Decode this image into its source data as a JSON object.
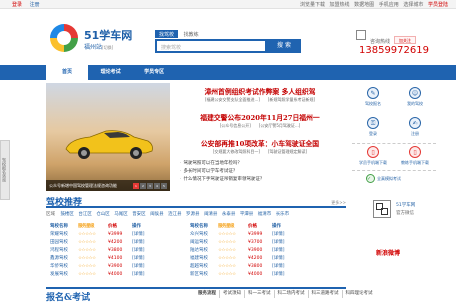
{
  "topbar": {
    "login": "登录",
    "register": "注册",
    "links": [
      "浏览量下载",
      "加盟热线",
      "数据地图",
      "手机应用",
      "选择城市",
      "学员登陆"
    ]
  },
  "brand": {
    "name": "51学车网",
    "city": "福州站",
    "city_tag": "[切换]"
  },
  "search": {
    "tabs": [
      "找驾校",
      "找教练"
    ],
    "placeholder": "搜索驾校",
    "button": "搜 索"
  },
  "contact": {
    "label": "咨询热线",
    "phone": "13859972619",
    "weibo": "加关注"
  },
  "nav": [
    "首页",
    "理论考试",
    "学员专区"
  ],
  "float_bar": "驾校报名咨询",
  "banner": {
    "caption": "公众号新增中国驾校管理法规咨询功能",
    "pages": [
      "1",
      "2",
      "3",
      "4",
      "5"
    ]
  },
  "news": {
    "headline1": "漳州首例组织考试作弊案 多人组织驾",
    "sub1": [
      "[福建公安交警支队全面推进...]",
      "[新规驾照学量系考证新规]"
    ],
    "headline2": "福建交警公布2020年11月27日福州一",
    "sub2": [
      "[公众号信息公开]",
      "[公安厅警5月驾驶证...]"
    ],
    "headline3": "公安部再推10项改革：小车驾驶证全国",
    "sub3": [
      "[交规要大修改驾照科目一]",
      "[驾驶证管理规定解读]"
    ],
    "list": [
      "驾驶驾照可以在当地年检吗？",
      "多长时间可以学车考试证？",
      "什么情况下手驾驶证吊销复审领驾驶证？"
    ]
  },
  "right": {
    "icons": [
      "驾校报名",
      "我的驾校",
      "登录",
      "注册"
    ],
    "study": [
      "学员手机端下载",
      "教练手机端下载"
    ],
    "sim": "全真模拟考试"
  },
  "section": {
    "title": "驾校推荐",
    "more": "更多>>"
  },
  "districts": {
    "label": "区域",
    "items": [
      "鼓楼区",
      "台江区",
      "仓山区",
      "马尾区",
      "晋安区",
      "闽侯县",
      "连江县",
      "罗源县",
      "闽清县",
      "永泰县",
      "平潭县",
      "福清市",
      "长乐市"
    ]
  },
  "table_left": {
    "headers": [
      "驾校名称",
      "服务星级",
      "价格",
      "操作"
    ],
    "rows": [
      [
        "荣耀驾校",
        "☆☆☆☆☆",
        "¥3999",
        "[详情]"
      ],
      [
        "田园驾校",
        "☆☆☆☆☆",
        "¥4200",
        "[详情]"
      ],
      [
        "鸿程驾校",
        "☆☆☆☆☆",
        "¥3800",
        "[详情]"
      ],
      [
        "鑫源驾校",
        "☆☆☆☆☆",
        "¥4100",
        "[详情]"
      ],
      [
        "华侨驾校",
        "☆☆☆☆☆",
        "¥3900",
        "[详情]"
      ],
      [
        "发展驾校",
        "☆☆☆☆☆",
        "¥4000",
        "[详情]"
      ]
    ]
  },
  "table_right": {
    "headers": [
      "驾校名称",
      "服务星级",
      "价格",
      "操作"
    ],
    "rows": [
      [
        "众兴驾校",
        "☆☆☆☆☆",
        "¥3999",
        "[详情]"
      ],
      [
        "闽运驾校",
        "☆☆☆☆☆",
        "¥3700",
        "[详情]"
      ],
      [
        "陆达驾校",
        "☆☆☆☆☆",
        "¥3900",
        "[详情]"
      ],
      [
        "福建驾校",
        "☆☆☆☆☆",
        "¥4200",
        "[详情]"
      ],
      [
        "超越驾校",
        "☆☆☆☆☆",
        "¥3800",
        "[详情]"
      ],
      [
        "新区驾校",
        "☆☆☆☆☆",
        "¥4000",
        "[详情]"
      ]
    ]
  },
  "app": {
    "title": "51学车网",
    "sub": "官方微信"
  },
  "weibo_label": "新浪微博",
  "bottom": {
    "title": "报名&考试",
    "tabs": [
      "服务流程",
      "考试须知",
      "科一三考试",
      "科二场内考试",
      "科三道路考试",
      "科四理论考试"
    ]
  }
}
